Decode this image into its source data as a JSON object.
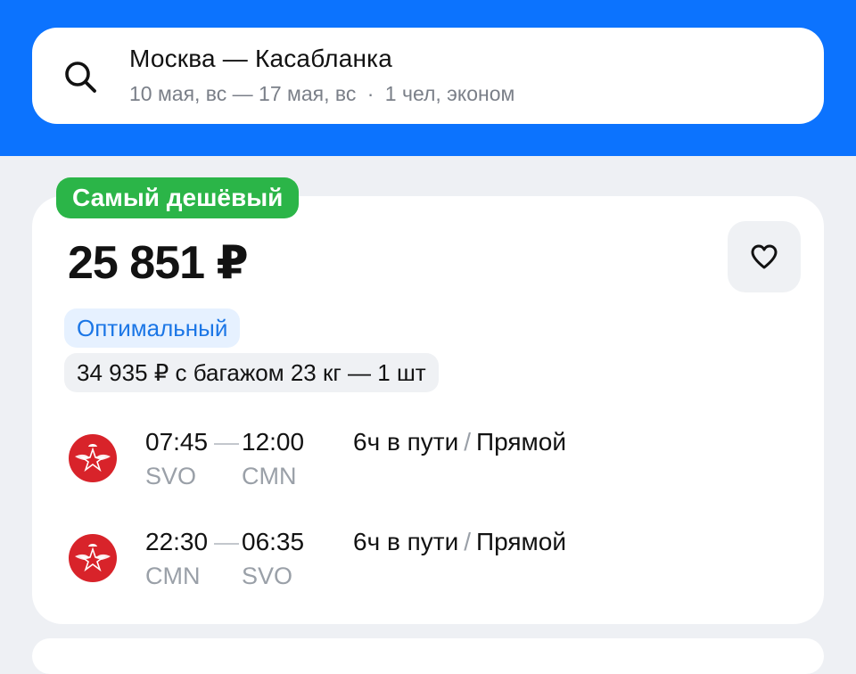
{
  "search": {
    "title": "Москва — Касабланка",
    "dates": "10 мая, вс — 17 мая, вс",
    "separator": "·",
    "passengers": "1 чел, эконом",
    "icon": "search-icon"
  },
  "offer": {
    "badge": "Самый дешёвый",
    "price": "25 851 ₽",
    "tag_optimal": "Оптимальный",
    "tag_baggage": "34 935 ₽ с багажом 23 кг — 1 шт",
    "favorite_icon": "heart-icon",
    "segments": [
      {
        "dep_time": "07:45",
        "arr_time": "12:00",
        "dep_code": "SVO",
        "arr_code": "CMN",
        "duration": "6ч в пути",
        "slash": "/",
        "type": "Прямой",
        "airline_icon": "royal-air-maroc-logo-icon"
      },
      {
        "dep_time": "22:30",
        "arr_time": "06:35",
        "dep_code": "CMN",
        "arr_code": "SVO",
        "duration": "6ч в пути",
        "slash": "/",
        "type": "Прямой",
        "airline_icon": "royal-air-maroc-logo-icon"
      }
    ]
  },
  "colors": {
    "brand_blue": "#0c73fe",
    "badge_green": "#2bb548",
    "optimal_text": "#1b76e6",
    "airline_red": "#d8232a"
  }
}
